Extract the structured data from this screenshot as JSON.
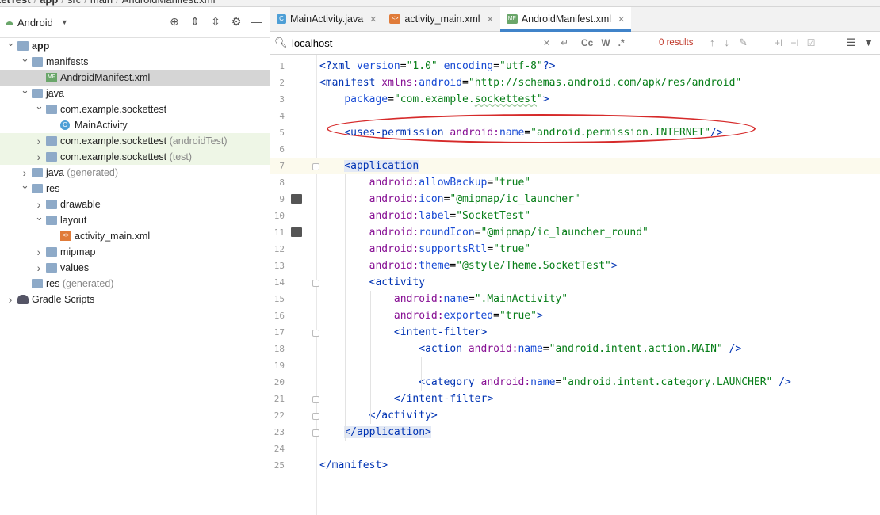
{
  "breadcrumb": [
    "ketTest",
    "app",
    "src",
    "main",
    "AndroidManifest.xml"
  ],
  "project": {
    "view_label": "Android",
    "tree": [
      {
        "label": "app",
        "level": 0,
        "arrow": "down",
        "icon": "folder",
        "bold": true
      },
      {
        "label": "manifests",
        "level": 1,
        "arrow": "down",
        "icon": "folder"
      },
      {
        "label": "AndroidManifest.xml",
        "level": 2,
        "icon": "mf",
        "selected": true
      },
      {
        "label": "java",
        "level": 1,
        "arrow": "down",
        "icon": "folder"
      },
      {
        "label": "com.example.sockettest",
        "level": 2,
        "arrow": "down",
        "icon": "folder"
      },
      {
        "label": "MainActivity",
        "level": 3,
        "icon": "class"
      },
      {
        "label": "com.example.sockettest",
        "suffix": "(androidTest)",
        "level": 2,
        "arrow": "right",
        "icon": "folder",
        "green": true
      },
      {
        "label": "com.example.sockettest",
        "suffix": "(test)",
        "level": 2,
        "arrow": "right",
        "icon": "folder",
        "green": true
      },
      {
        "label": "java",
        "suffix": "(generated)",
        "level": 1,
        "arrow": "right",
        "icon": "folder"
      },
      {
        "label": "res",
        "level": 1,
        "arrow": "down",
        "icon": "folder"
      },
      {
        "label": "drawable",
        "level": 2,
        "arrow": "right",
        "icon": "folder"
      },
      {
        "label": "layout",
        "level": 2,
        "arrow": "down",
        "icon": "folder"
      },
      {
        "label": "activity_main.xml",
        "level": 3,
        "icon": "xml"
      },
      {
        "label": "mipmap",
        "level": 2,
        "arrow": "right",
        "icon": "folder"
      },
      {
        "label": "values",
        "level": 2,
        "arrow": "right",
        "icon": "folder"
      },
      {
        "label": "res",
        "suffix": "(generated)",
        "level": 1,
        "icon": "folder"
      },
      {
        "label": "Gradle Scripts",
        "level": 0,
        "arrow": "right",
        "icon": "gradle"
      }
    ]
  },
  "tabs": [
    {
      "label": "MainActivity.java",
      "icon": "class",
      "active": false
    },
    {
      "label": "activity_main.xml",
      "icon": "xml",
      "active": false
    },
    {
      "label": "AndroidManifest.xml",
      "icon": "mf",
      "active": true
    }
  ],
  "search": {
    "query": "localhost",
    "match_case": "Cc",
    "words": "W",
    "regex": ".*",
    "results": "0 results"
  },
  "editor": {
    "lines": [
      "<?xml version=\"1.0\" encoding=\"utf-8\"?>",
      "<manifest xmlns:android=\"http://schemas.android.com/apk/res/android\"",
      "    package=\"com.example.sockettest\">",
      "",
      "    <uses-permission android:name=\"android.permission.INTERNET\"/>",
      "",
      "    <application",
      "        android:allowBackup=\"true\"",
      "        android:icon=\"@mipmap/ic_launcher\"",
      "        android:label=\"SocketTest\"",
      "        android:roundIcon=\"@mipmap/ic_launcher_round\"",
      "        android:supportsRtl=\"true\"",
      "        android:theme=\"@style/Theme.SocketTest\">",
      "        <activity",
      "            android:name=\".MainActivity\"",
      "            android:exported=\"true\">",
      "            <intent-filter>",
      "                <action android:name=\"android.intent.action.MAIN\" />",
      "",
      "                <category android:name=\"android.intent.category.LAUNCHER\" />",
      "            </intent-filter>",
      "        </activity>",
      "    </application>",
      "",
      "</manifest>"
    ],
    "current_line": 7,
    "gutter_icon_lines": [
      9,
      11
    ],
    "fold_lines": [
      7,
      14,
      17,
      21,
      22,
      23
    ]
  }
}
